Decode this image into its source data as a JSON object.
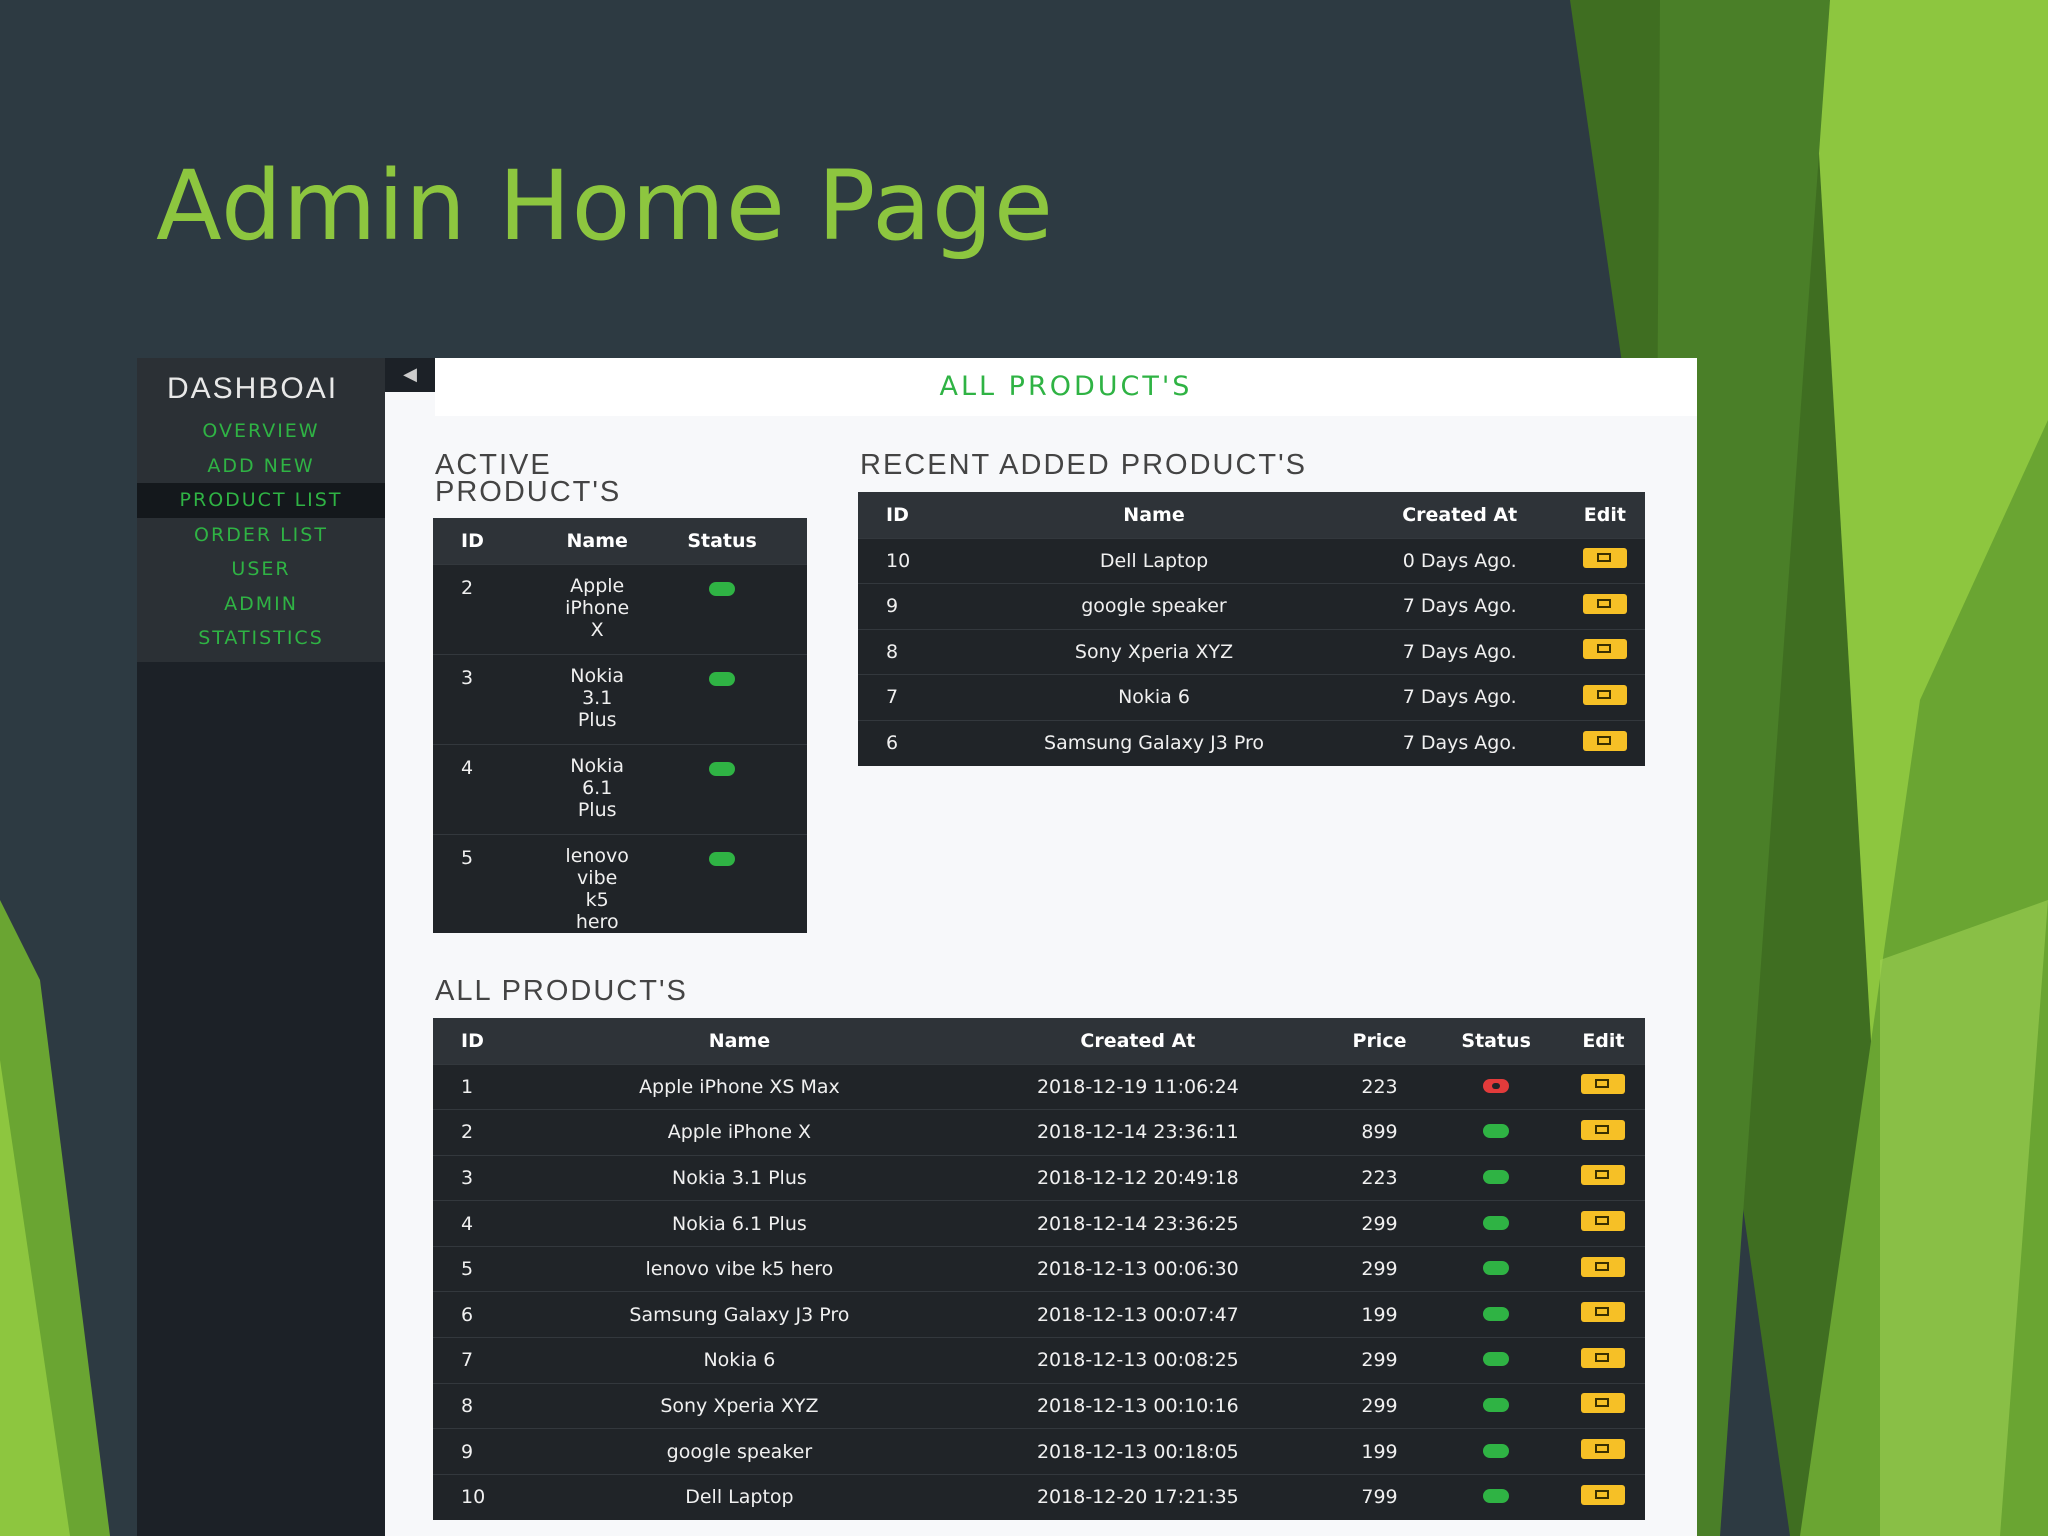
{
  "slide": {
    "title": "Admin Home Page"
  },
  "colors": {
    "accent_green": "#8dc63f",
    "status_ok": "#2fb344",
    "status_bad": "#e23b3b",
    "edit_button": "#f6c026",
    "table_bg": "#202428"
  },
  "sidebar": {
    "brand": "DASHBOAI",
    "toggle_icon": "◀",
    "items": [
      {
        "label": "OVERVIEW"
      },
      {
        "label": "ADD NEW"
      },
      {
        "label": "PRODUCT LIST",
        "active": true
      },
      {
        "label": "ORDER LIST"
      },
      {
        "label": "USER"
      },
      {
        "label": "ADMIN"
      },
      {
        "label": "STATISTICS"
      }
    ]
  },
  "header": {
    "title": "ALL PRODUCT'S"
  },
  "active_products": {
    "title": "ACTIVE PRODUCT'S",
    "columns": [
      "ID",
      "Name",
      "Status"
    ],
    "rows": [
      {
        "id": "2",
        "name": "Apple iPhone X",
        "status": "ok"
      },
      {
        "id": "3",
        "name": "Nokia 3.1 Plus",
        "status": "ok"
      },
      {
        "id": "4",
        "name": "Nokia 6.1 Plus",
        "status": "ok"
      },
      {
        "id": "5",
        "name": "lenovo vibe k5 hero",
        "status": "ok"
      }
    ]
  },
  "recent_products": {
    "title": "RECENT ADDED PRODUCT'S",
    "columns": [
      "ID",
      "Name",
      "Created At",
      "Edit"
    ],
    "rows": [
      {
        "id": "10",
        "name": "Dell Laptop",
        "created": "0 Days Ago."
      },
      {
        "id": "9",
        "name": "google speaker",
        "created": "7 Days Ago."
      },
      {
        "id": "8",
        "name": "Sony Xperia XYZ",
        "created": "7 Days Ago."
      },
      {
        "id": "7",
        "name": "Nokia 6",
        "created": "7 Days Ago."
      },
      {
        "id": "6",
        "name": "Samsung Galaxy J3 Pro",
        "created": "7 Days Ago."
      }
    ]
  },
  "all_products": {
    "title": "ALL PRODUCT'S",
    "columns": [
      "ID",
      "Name",
      "Created At",
      "Price",
      "Status",
      "Edit"
    ],
    "rows": [
      {
        "id": "1",
        "name": "Apple iPhone XS Max",
        "created": "2018-12-19 11:06:24",
        "price": "223",
        "status": "bad"
      },
      {
        "id": "2",
        "name": "Apple iPhone X",
        "created": "2018-12-14 23:36:11",
        "price": "899",
        "status": "ok"
      },
      {
        "id": "3",
        "name": "Nokia 3.1 Plus",
        "created": "2018-12-12 20:49:18",
        "price": "223",
        "status": "ok"
      },
      {
        "id": "4",
        "name": "Nokia 6.1 Plus",
        "created": "2018-12-14 23:36:25",
        "price": "299",
        "status": "ok"
      },
      {
        "id": "5",
        "name": "lenovo vibe k5 hero",
        "created": "2018-12-13 00:06:30",
        "price": "299",
        "status": "ok"
      },
      {
        "id": "6",
        "name": "Samsung Galaxy J3 Pro",
        "created": "2018-12-13 00:07:47",
        "price": "199",
        "status": "ok"
      },
      {
        "id": "7",
        "name": "Nokia 6",
        "created": "2018-12-13 00:08:25",
        "price": "299",
        "status": "ok"
      },
      {
        "id": "8",
        "name": "Sony Xperia XYZ",
        "created": "2018-12-13 00:10:16",
        "price": "299",
        "status": "ok"
      },
      {
        "id": "9",
        "name": "google speaker",
        "created": "2018-12-13 00:18:05",
        "price": "199",
        "status": "ok"
      },
      {
        "id": "10",
        "name": "Dell Laptop",
        "created": "2018-12-20 17:21:35",
        "price": "799",
        "status": "ok"
      }
    ]
  }
}
